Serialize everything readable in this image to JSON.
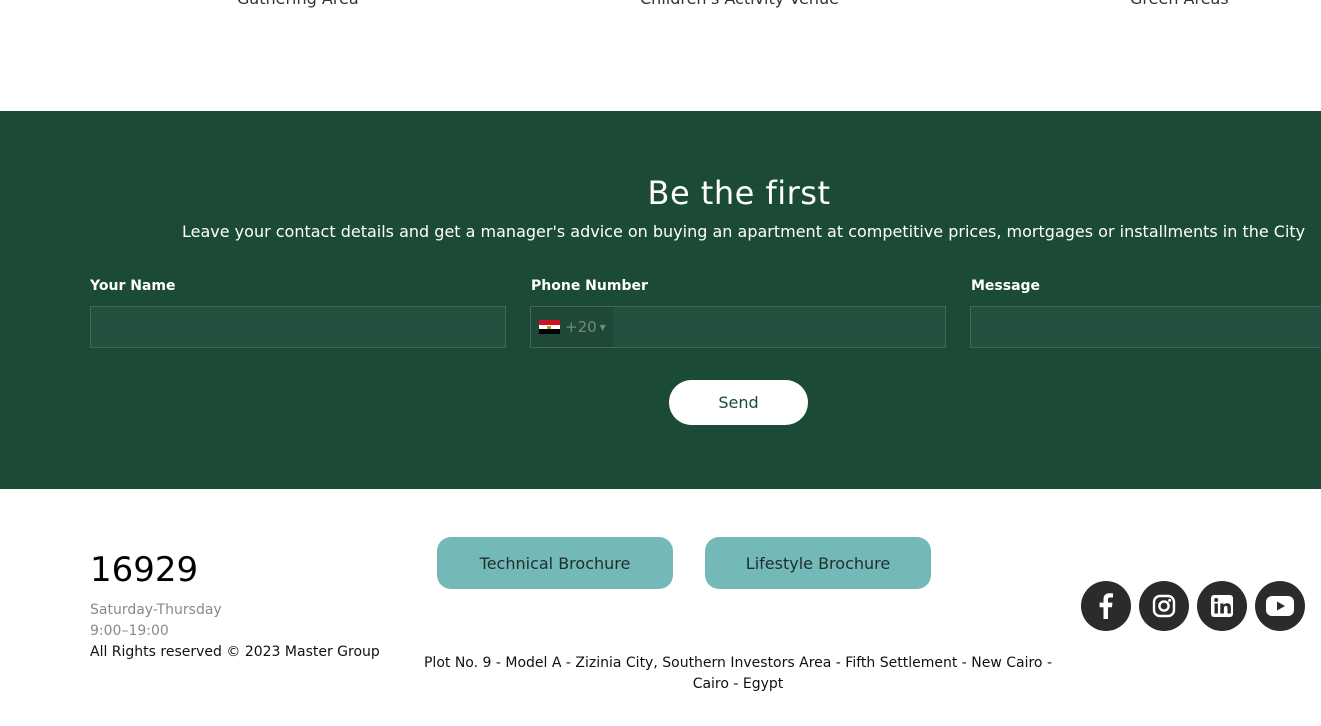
{
  "amenities": {
    "items": [
      "Gathering Area",
      "Children's Activity Venue",
      "Green Areas"
    ]
  },
  "contact": {
    "title": "Be the first",
    "subtitle": "Leave your contact details and get a manager's advice on buying an apartment at competitive prices, mortgages or installments in the City",
    "fields": {
      "name_label": "Your Name",
      "phone_label": "Phone Number",
      "message_label": "Message",
      "country_code": "+20"
    },
    "send_label": "Send"
  },
  "footer": {
    "hotline": "16929",
    "days": "Saturday-Thursday",
    "hours": "9:00–19:00",
    "rights": "All Rights reserved © 2023 Master Group",
    "brochures": [
      "Technical Brochure",
      "Lifestyle Brochure"
    ],
    "address": "Plot No. 9 - Model A - Zizinia City, Southern Investors Area - Fifth Settlement - New Cairo - Cairo - Egypt",
    "social": [
      "facebook-icon",
      "instagram-icon",
      "linkedin-icon",
      "youtube-icon"
    ]
  },
  "colors": {
    "band": "#1b4a37",
    "brochure": "#72b9b8",
    "social": "#2b2b2b"
  }
}
